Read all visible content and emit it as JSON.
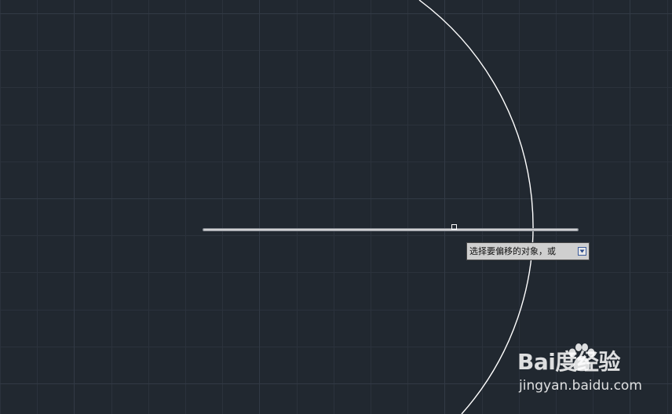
{
  "canvas": {
    "background": "#212830",
    "grid_color": "#2b323c",
    "grid_major_color": "#323a45",
    "geometry_color": "#ffffff"
  },
  "tooltip": {
    "text": "选择要偏移的对象，或",
    "arrow_icon": "down-arrow-icon"
  },
  "watermark": {
    "brand": "Bai度经验",
    "url": "jingyan.baidu.com",
    "logo_icon": "paw-print-icon"
  }
}
